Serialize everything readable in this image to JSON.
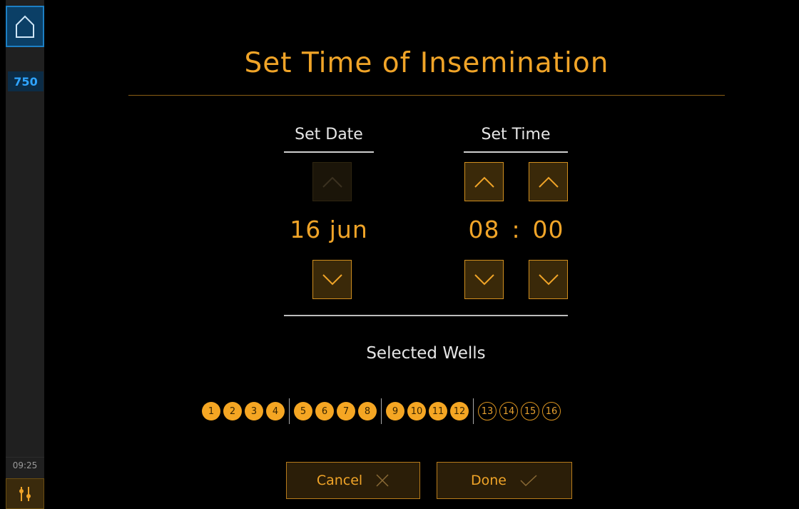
{
  "sidebar": {
    "counter": "750",
    "clock": "09:25",
    "accent": "#1c7fc4"
  },
  "title": "Set Time of Insemination",
  "date_section": {
    "label": "Set Date",
    "value": "16 jun"
  },
  "time_section": {
    "label": "Set Time",
    "hours": "08",
    "separator": ":",
    "minutes": "00"
  },
  "wells": {
    "label": "Selected Wells",
    "groups": [
      [
        {
          "n": "1",
          "selected": true
        },
        {
          "n": "2",
          "selected": true
        },
        {
          "n": "3",
          "selected": true
        },
        {
          "n": "4",
          "selected": true
        }
      ],
      [
        {
          "n": "5",
          "selected": true
        },
        {
          "n": "6",
          "selected": true
        },
        {
          "n": "7",
          "selected": true
        },
        {
          "n": "8",
          "selected": true
        }
      ],
      [
        {
          "n": "9",
          "selected": true
        },
        {
          "n": "10",
          "selected": true
        },
        {
          "n": "11",
          "selected": true
        },
        {
          "n": "12",
          "selected": true
        }
      ],
      [
        {
          "n": "13",
          "selected": false
        },
        {
          "n": "14",
          "selected": false
        },
        {
          "n": "15",
          "selected": false
        },
        {
          "n": "16",
          "selected": false
        }
      ]
    ]
  },
  "buttons": {
    "cancel": "Cancel",
    "done": "Done"
  },
  "colors": {
    "accent": "#f0a428",
    "well_fill": "#f5a623"
  }
}
